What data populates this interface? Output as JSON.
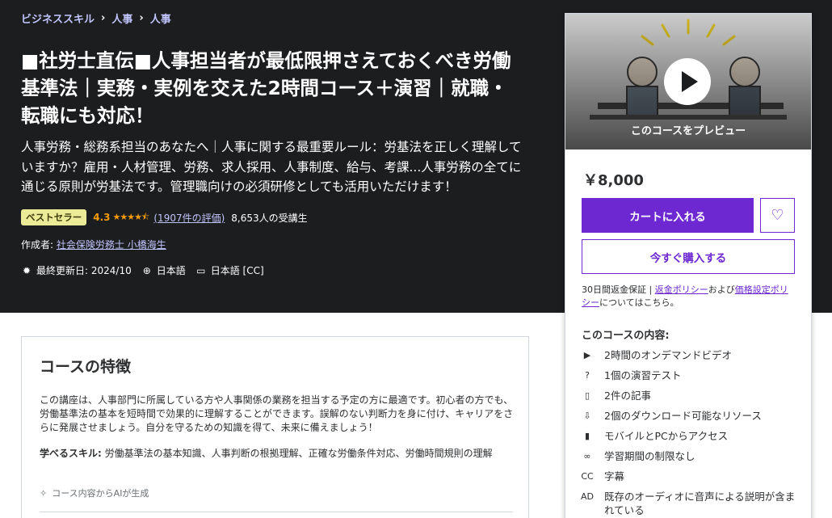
{
  "breadcrumb": [
    {
      "label": "ビジネススキル"
    },
    {
      "label": "人事"
    },
    {
      "label": "人事"
    }
  ],
  "course": {
    "title": "■社労士直伝■人事担当者が最低限押さえておくべき労働基準法｜実務・実例を交えた2時間コース＋演習｜就職・転職にも対応！",
    "subtitle": "人事労務・総務系担当のあなたへ｜人事に関する最重要ルール：労基法を正しく理解していますか？雇用・人材管理、労務、求人採用、人事制度、給与、考課...人事労務の全てに通じる原則が労基法です。管理職向けの必須研修としても活用いただけます！",
    "badge": "ベストセラー",
    "rating": "4.3",
    "stars": "★★★★⯪",
    "rating_count": "(1907件の評価)",
    "students": "8,653人の受講生",
    "author_prefix": "作成者:",
    "author": "社会保険労務士 小橋海生",
    "updated": "最終更新日: 2024/10",
    "language": "日本語",
    "captions": "日本語 [CC]"
  },
  "sidebar": {
    "preview_label": "このコースをプレビュー",
    "price": "￥8,000",
    "cart_label": "カートに入れる",
    "buy_label": "今すぐ購入する",
    "guarantee_prefix": "30日間返金保証 | ",
    "refund_policy": "返金ポリシー",
    "and": "および",
    "pricing_policy": "価格設定ポリシー",
    "guarantee_suffix": "についてはこちら。",
    "includes_title": "このコースの内容:",
    "includes": [
      {
        "icon": "video-icon",
        "glyph": "▶",
        "label": "2時間のオンデマンドビデオ"
      },
      {
        "icon": "quiz-icon",
        "glyph": "?",
        "label": "1個の演習テスト"
      },
      {
        "icon": "file-icon",
        "glyph": "▯",
        "label": "2件の記事"
      },
      {
        "icon": "download-folder-icon",
        "glyph": "⇩",
        "label": "2個のダウンロード可能なリソース"
      },
      {
        "icon": "mobile-icon",
        "glyph": "▮",
        "label": "モバイルとPCからアクセス"
      },
      {
        "icon": "infinity-icon",
        "glyph": "∞",
        "label": "学習期間の制限なし"
      },
      {
        "icon": "captions-icon",
        "glyph": "CC",
        "label": "字幕"
      },
      {
        "icon": "audio-description-icon",
        "glyph": "AD",
        "label": "既存のオーディオに音声による説明が含まれている"
      }
    ]
  },
  "features": {
    "title": "コースの特徴",
    "body": "この講座は、人事部門に所属している方や人事関係の業務を担当する予定の方に最適です。初心者の方でも、労働基準法の基本を短時間で効果的に理解することができます。誤解のない判断力を身に付け、キャリアをさらに発展させましょう。自分を守るための知識を得て、未来に備えましょう！",
    "skills_label": "学べるスキル:",
    "skills": " 労働基準法の基本知識、人事判断の根拠理解、正確な労働条件対応、労働時間規則の理解",
    "ai_note": "コース内容からAIが生成"
  },
  "colors": {
    "hero_bg": "#1c1d1f",
    "accent": "#6d28d2",
    "link": "#c0c4fc",
    "rating": "#f69c08",
    "badge_bg": "#eceb98"
  }
}
